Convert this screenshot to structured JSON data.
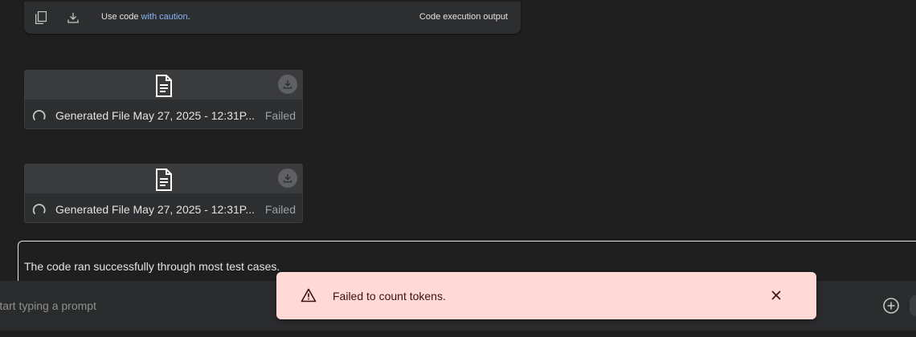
{
  "code_toolbar": {
    "caution_prefix": "Use code ",
    "caution_link": "with caution",
    "caution_suffix": ".",
    "exec_output_label": "Code execution output",
    "icons": [
      "copy-icon",
      "download-icon"
    ]
  },
  "files": [
    {
      "name": "Generated File May 27, 2025 - 12:31P...",
      "status": "Failed"
    },
    {
      "name": "Generated File May 27, 2025 - 12:31P...",
      "status": "Failed"
    }
  ],
  "message": {
    "text": "The code ran successfully through most test cases."
  },
  "prompt": {
    "placeholder": "Start typing a prompt"
  },
  "toast": {
    "text": "Failed to count tokens.",
    "background": "#ffdad6",
    "icon": "warning-icon"
  },
  "colors": {
    "background": "#1f1f1f",
    "card": "#2d2e30",
    "link": "#8ab4f8"
  }
}
